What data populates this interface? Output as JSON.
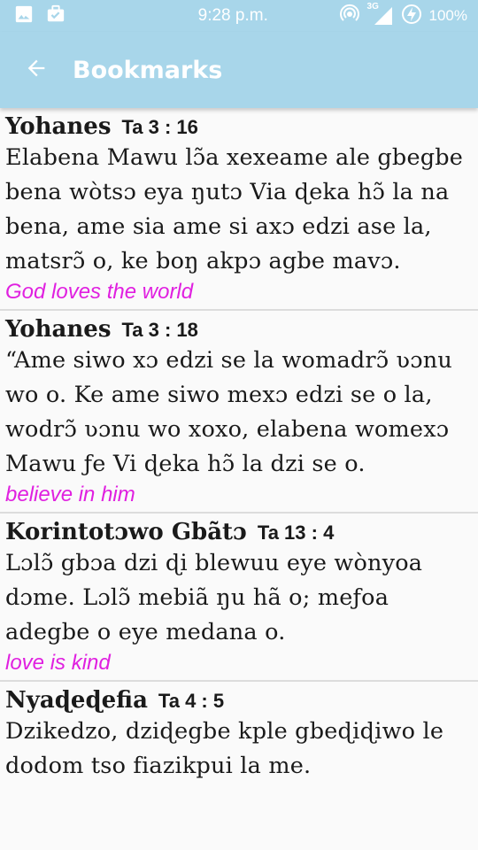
{
  "status_bar": {
    "time": "9:28 p.m.",
    "network": "3G",
    "battery": "100%",
    "icons": [
      "image-icon",
      "briefcase-check-icon",
      "hotspot-icon",
      "signal-icon",
      "battery-charging-icon"
    ]
  },
  "toolbar": {
    "title": "Bookmarks",
    "back_icon": "arrow-left-icon",
    "background": "#a8d6ea"
  },
  "bookmarks": [
    {
      "book": "Yohanes",
      "chapter": "Ta 3 : 16",
      "text": "Elabena Mawu lɔ̃a xexeame ale gbegbe bena wòtsɔ eya ŋutɔ Via ɖeka hɔ̃ la na bena, ame sia ame si axɔ edzi ase la, matsrɔ̃ o, ke boŋ akpɔ agbe mavɔ.",
      "note": "God loves the world"
    },
    {
      "book": "Yohanes",
      "chapter": "Ta 3 : 18",
      "text": "“Ame siwo xɔ edzi se la womadrɔ̃ ʋɔnu wo o. Ke ame siwo mexɔ edzi se o la, wodrɔ̃ ʋɔnu wo xoxo, elabena womexɔ Mawu ƒe Vi ɖeka hɔ̃ la dzi se o.",
      "note": "believe in him"
    },
    {
      "book": "Korintotɔwo Gbãtɔ",
      "chapter": "Ta 13 : 4",
      "text": "Lɔlɔ̃ gbɔa dzi ɖi blewuu eye wònyoa dɔme. Lɔlɔ̃ mebiã ŋu hã o; meƒoa adegbe o eye medana o.",
      "note": "love is kind"
    },
    {
      "book": "Nyaɖeɖefia",
      "chapter": "Ta 4 : 5",
      "text": "Dzikedzo, dziɖegbe kple gbeɖiɖiwo le dodom tso fiazikpui la me.",
      "note": ""
    }
  ],
  "colors": {
    "note": "#e020e0",
    "divider": "#dcdcdc",
    "text": "#1a1a1a"
  }
}
